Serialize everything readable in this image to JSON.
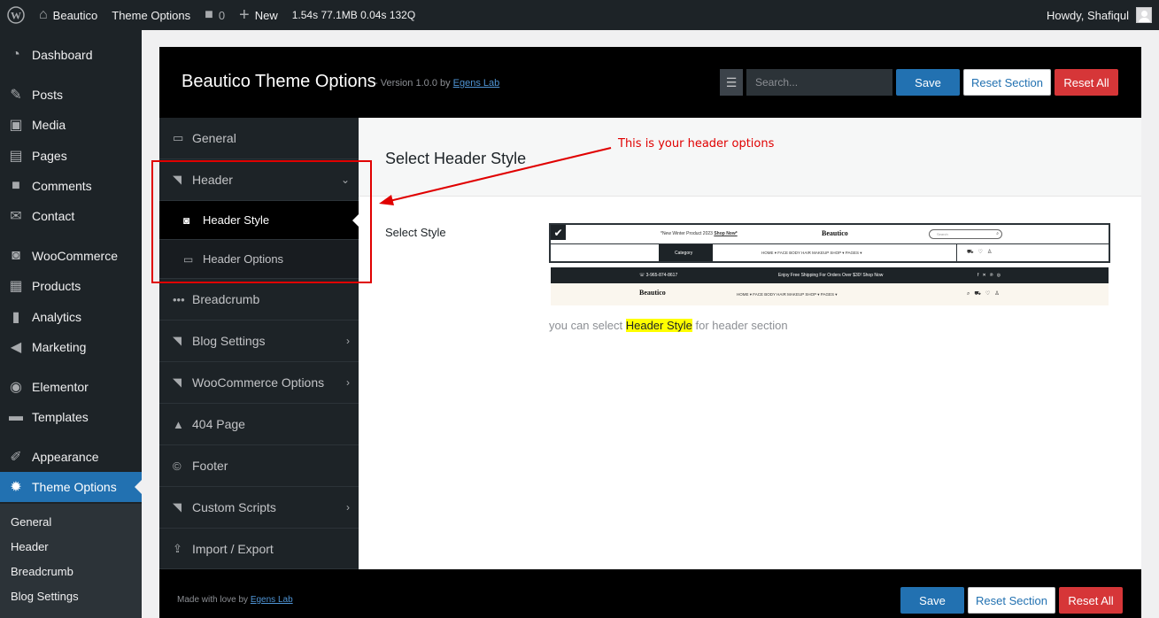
{
  "adminbar": {
    "site_name": "Beautico",
    "theme_options": "Theme Options",
    "comments_count": "0",
    "new_label": "New",
    "perf": "1.54s  77.1MB  0.04s  132Q",
    "howdy": "Howdy, Shafiqul"
  },
  "adminmenu": {
    "items": [
      {
        "label": "Dashboard",
        "icon": "dashboard-icon"
      },
      {
        "label": "Posts",
        "icon": "pin-icon"
      },
      {
        "label": "Media",
        "icon": "media-icon"
      },
      {
        "label": "Pages",
        "icon": "page-icon"
      },
      {
        "label": "Comments",
        "icon": "comment-icon"
      },
      {
        "label": "Contact",
        "icon": "mail-icon"
      },
      {
        "label": "WooCommerce",
        "icon": "woo-icon"
      },
      {
        "label": "Products",
        "icon": "archive-icon"
      },
      {
        "label": "Analytics",
        "icon": "chart-icon"
      },
      {
        "label": "Marketing",
        "icon": "megaphone-icon"
      },
      {
        "label": "Elementor",
        "icon": "elementor-icon"
      },
      {
        "label": "Templates",
        "icon": "folder-icon"
      },
      {
        "label": "Appearance",
        "icon": "brush-icon"
      },
      {
        "label": "Theme Options",
        "icon": "gear-icon"
      }
    ],
    "submenu": [
      "General",
      "Header",
      "Breadcrumb",
      "Blog Settings"
    ]
  },
  "options": {
    "title": "Beautico Theme Options",
    "version_prefix": "- Version 1.0.0  by",
    "author": "Egens Lab",
    "search_placeholder": "Search...",
    "save": "Save",
    "reset_section": "Reset Section",
    "reset_all": "Reset All",
    "nav": [
      {
        "label": "General"
      },
      {
        "label": "Header"
      },
      {
        "label": "Header Style"
      },
      {
        "label": "Header Options"
      },
      {
        "label": "Breadcrumb"
      },
      {
        "label": "Blog Settings"
      },
      {
        "label": "WooCommerce Options"
      },
      {
        "label": "404 Page"
      },
      {
        "label": "Footer"
      },
      {
        "label": "Custom Scripts"
      },
      {
        "label": "Import / Export"
      }
    ],
    "section_title": "Select Header Style",
    "field_label": "Select Style",
    "desc_before": "you can select ",
    "desc_highlight": "Header Style",
    "desc_after": " for header section",
    "footer_credit": "Made with love by",
    "footer_author": "Egens Lab"
  },
  "preview1": {
    "promo": "*New Winter Product 2023",
    "shop_now": "Shop Now*",
    "logo": "Beautico",
    "search": "Search",
    "category": "Category",
    "menu": "HOME ▾    FACE    BODY    HAIR    MAKEUP    SHOP ▾    PAGES ▾"
  },
  "preview2": {
    "phone": "☏ 3-965-874-8617",
    "shipping": "Enjoy Free Shipping For Orders Over $30! Shop Now",
    "logo": "Beautico",
    "menu": "HOME ▾    FACE    BODY    HAIR    MAKEUP    SHOP ▾    PAGES ▾"
  },
  "annotation": {
    "text": "This is your header options",
    "color": "#e00000"
  }
}
